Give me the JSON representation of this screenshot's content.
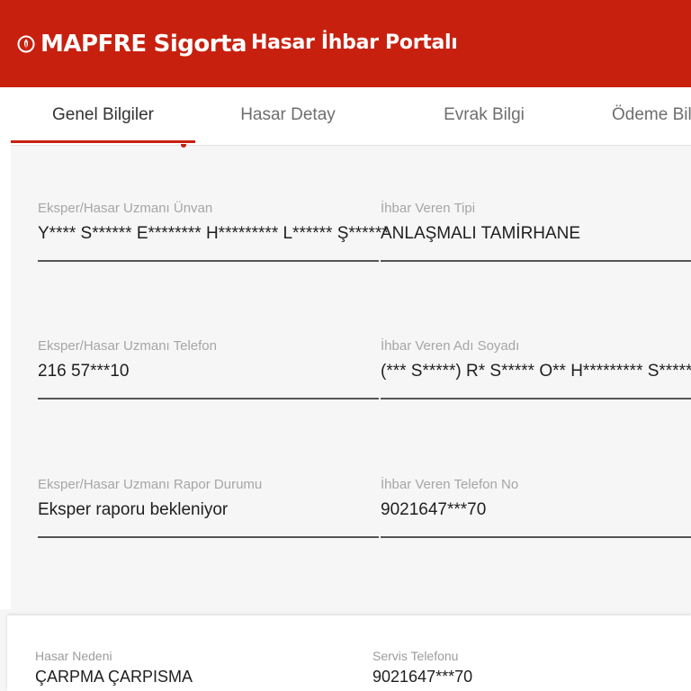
{
  "header": {
    "brand": "MAPFRE",
    "brand_sub": "Sigorta",
    "portal_title": "Hasar İhbar Portalı",
    "logo_icon": "mapfre-logo-icon",
    "background_color": "#c8200f"
  },
  "tabs": [
    {
      "label": "Genel Bilgiler",
      "active": true
    },
    {
      "label": "Hasar Detay",
      "active": false
    },
    {
      "label": "Evrak Bilgi",
      "active": false
    },
    {
      "label": "Ödeme Bilgi",
      "active": false
    }
  ],
  "fields": [
    {
      "label": "Eksper/Hasar Uzmanı Ünvan",
      "value": "Y**** S****** E******** H********* L****** Ş******"
    },
    {
      "label": "İhbar Veren Tipi",
      "value": "ANLAŞMALI TAMİRHANE"
    },
    {
      "label": "Eksper/Hasar Uzmanı Telefon",
      "value": "216 57***10"
    },
    {
      "label": "İhbar Veren Adı Soyadı",
      "value": "(*** S*****) R* S***** O** H********* S***** V* D"
    },
    {
      "label": "Eksper/Hasar Uzmanı Rapor Durumu",
      "value": "Eksper raporu bekleniyor"
    },
    {
      "label": "İhbar Veren Telefon No",
      "value": "9021647***70"
    }
  ],
  "bottom": [
    {
      "label": "Hasar Nedeni",
      "value": "ÇARPMA ÇARPISMA"
    },
    {
      "label": "Servis Telefonu",
      "value": "9021647***70"
    }
  ],
  "colors": {
    "accent": "#c8200f",
    "label": "#a6a6a6",
    "value": "#1f1f1f"
  }
}
